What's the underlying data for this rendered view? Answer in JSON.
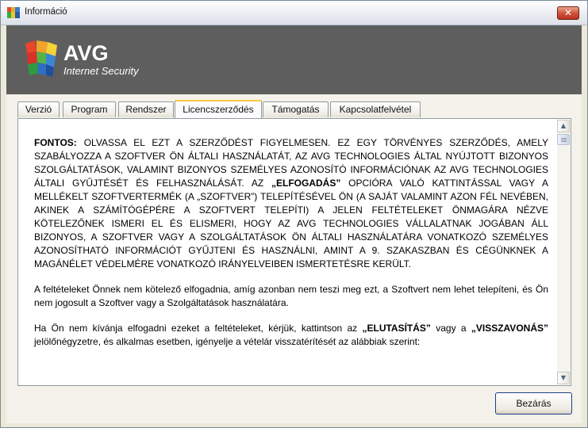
{
  "window": {
    "title": "Információ",
    "close_glyph": "✕"
  },
  "brand": {
    "name": "AVG",
    "product": "Internet Security",
    "icon": "avg-logo-icon"
  },
  "tabs": [
    {
      "label": "Verzió",
      "active": false
    },
    {
      "label": "Program",
      "active": false
    },
    {
      "label": "Rendszer",
      "active": false
    },
    {
      "label": "Licencszerződés",
      "active": true
    },
    {
      "label": "Támogatás",
      "active": false
    },
    {
      "label": "Kapcsolatfelvétel",
      "active": false
    }
  ],
  "license": {
    "p1_b1": "FONTOS:",
    "p1_t1": " OLVASSA EL EZT A SZERZŐDÉST FIGYELMESEN. EZ EGY TÖRVÉNYES SZERZŐDÉS, AMELY SZABÁLYOZZA A SZOFTVER ÖN ÁLTALI HASZNÁLATÁT, AZ AVG TECHNOLOGIES ÁLTAL NYÚJTOTT BIZONYOS SZOLGÁLTATÁSOK, VALAMINT BIZONYOS SZEMÉLYES AZONOSÍTÓ INFORMÁCIÓNAK AZ AVG TECHNOLOGIES ÁLTALI GYŰJTÉSÉT ÉS FELHASZNÁLÁSÁT. AZ ",
    "p1_b2": "„ELFOGADÁS”",
    "p1_t2": " OPCIÓRA VALÓ KATTINTÁSSAL VAGY A MELLÉKELT SZOFTVERTERMÉK (A „SZOFTVER”) TELEPÍTÉSÉVEL ÖN (A SAJÁT VALAMINT AZON FÉL NEVÉBEN, AKINEK A SZÁMÍTÓGÉPÉRE A SZOFTVERT TELEPÍTI) A JELEN FELTÉTELEKET ÖNMAGÁRA NÉZVE KÖTELEZŐNEK ISMERI EL ÉS ELISMERI, HOGY AZ AVG TECHNOLOGIES VÁLLALATNAK JOGÁBAN ÁLL BIZONYOS, A SZOFTVER VAGY A SZOLGÁLTATÁSOK ÖN ÁLTALI HASZNÁLATÁRA VONATKOZÓ SZEMÉLYES AZONOSÍTHATÓ INFORMÁCIÓT GYŰJTENI ÉS HASZNÁLNI, AMINT A 9. SZAKASZBAN ÉS CÉGÜNKNEK A MAGÁNÉLET VÉDELMÉRE VONATKOZÓ IRÁNYELVEIBEN ISMERTETÉSRE KERÜLT.",
    "p2": "A feltételeket Önnek nem kötelező elfogadnia, amíg azonban nem teszi meg ezt, a Szoftvert nem lehet telepíteni, és Ön nem jogosult a Szoftver vagy a Szolgáltatások használatára.",
    "p3_t1": "Ha Ön nem kívánja elfogadni ezeket a feltételeket, kérjük, kattintson az ",
    "p3_b1": "„ELUTASÍTÁS”",
    "p3_t2": " vagy a ",
    "p3_b2": "„VISSZAVONÁS”",
    "p3_t3": " jelölőnégyzetre, és alkalmas esetben, igényelje a vételár visszatérítését az alábbiak szerint:"
  },
  "scrollbar": {
    "up": "▲",
    "down": "▼"
  },
  "buttons": {
    "close": "Bezárás"
  }
}
